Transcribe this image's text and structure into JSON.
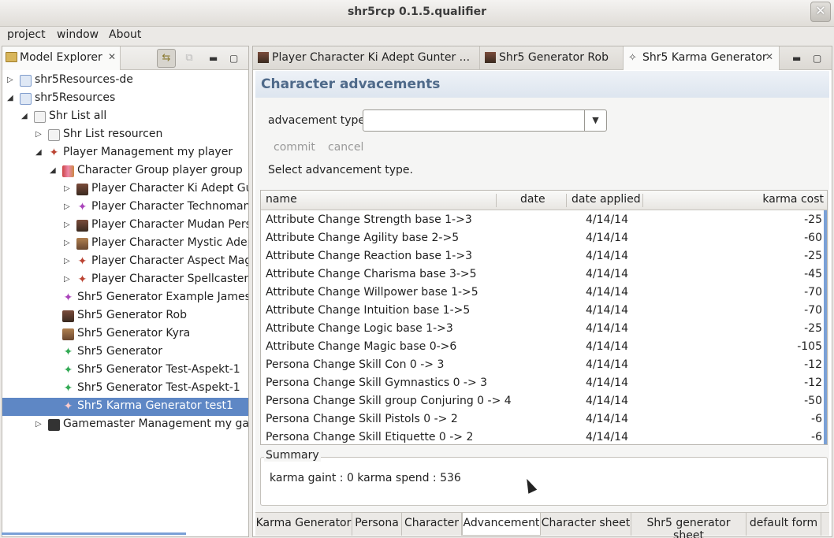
{
  "window": {
    "title": "shr5rcp 0.1.5.qualifier",
    "close_glyph": "✕"
  },
  "menu": [
    "project",
    "window",
    "About"
  ],
  "explorer": {
    "tab_label": "Model Explorer",
    "close_glyph": "✕",
    "tree": [
      {
        "label": "shr5Resources-de",
        "arrow": "▷"
      },
      {
        "label": "shr5Resources",
        "arrow": "◢"
      },
      {
        "label": "Shr List all",
        "arrow": "◢"
      },
      {
        "label": "Shr List resourcen",
        "arrow": "▷"
      },
      {
        "label": "Player Management my player",
        "arrow": "◢"
      },
      {
        "label": "Character Group player group",
        "arrow": "◢"
      },
      {
        "label": "Player Character Ki Adept Gunter",
        "arrow": "▷"
      },
      {
        "label": "Player Character Technomancer",
        "arrow": "▷"
      },
      {
        "label": "Player Character Mudan Persona",
        "arrow": "▷"
      },
      {
        "label": "Player Character Mystic Adept",
        "arrow": "▷"
      },
      {
        "label": "Player Character Aspect Magic",
        "arrow": "▷"
      },
      {
        "label": "Player Character Spellcaster t",
        "arrow": "▷"
      },
      {
        "label": "Shr5 Generator Example James",
        "arrow": ""
      },
      {
        "label": "Shr5 Generator Rob",
        "arrow": ""
      },
      {
        "label": "Shr5 Generator Kyra",
        "arrow": ""
      },
      {
        "label": "Shr5 Generator",
        "arrow": ""
      },
      {
        "label": "Shr5 Generator Test-Aspekt-1",
        "arrow": ""
      },
      {
        "label": "Shr5 Generator Test-Aspekt-1",
        "arrow": ""
      },
      {
        "label": "Shr5 Karma Generator test1",
        "arrow": ""
      },
      {
        "label": "Gamemaster Management my gam",
        "arrow": "▷"
      }
    ]
  },
  "editor_tabs": [
    {
      "label": "Player Character Ki Adept Gunter ..."
    },
    {
      "label": "Shr5 Generator Rob"
    },
    {
      "label": "Shr5 Karma Generator",
      "close_glyph": "✕"
    }
  ],
  "form": {
    "title": "Character advacements",
    "advancement_type_label": "advacement type",
    "advancement_type_value": "",
    "commit_label": "commit",
    "cancel_label": "cancel",
    "hint": "Select advancement type.",
    "columns": {
      "name": "name",
      "date": "date",
      "date_applied": "date applied",
      "karma_cost": "karma cost"
    },
    "rows": [
      {
        "name": "Attribute Change Strength base 1->3",
        "date": "",
        "date_applied": "4/14/14",
        "karma_cost": "-25"
      },
      {
        "name": "Attribute Change Agility base 2->5",
        "date": "",
        "date_applied": "4/14/14",
        "karma_cost": "-60"
      },
      {
        "name": "Attribute Change Reaction base 1->3",
        "date": "",
        "date_applied": "4/14/14",
        "karma_cost": "-25"
      },
      {
        "name": "Attribute Change Charisma base 3->5",
        "date": "",
        "date_applied": "4/14/14",
        "karma_cost": "-45"
      },
      {
        "name": "Attribute Change Willpower base 1->5",
        "date": "",
        "date_applied": "4/14/14",
        "karma_cost": "-70"
      },
      {
        "name": "Attribute Change Intuition base 1->5",
        "date": "",
        "date_applied": "4/14/14",
        "karma_cost": "-70"
      },
      {
        "name": "Attribute Change Logic base 1->3",
        "date": "",
        "date_applied": "4/14/14",
        "karma_cost": "-25"
      },
      {
        "name": "Attribute Change Magic base 0->6",
        "date": "",
        "date_applied": "4/14/14",
        "karma_cost": "-105"
      },
      {
        "name": "Persona Change Skill Con 0 -> 3",
        "date": "",
        "date_applied": "4/14/14",
        "karma_cost": "-12"
      },
      {
        "name": "Persona Change Skill Gymnastics 0 -> 3",
        "date": "",
        "date_applied": "4/14/14",
        "karma_cost": "-12"
      },
      {
        "name": "Persona Change Skill group Conjuring 0 -> 4",
        "date": "",
        "date_applied": "4/14/14",
        "karma_cost": "-50"
      },
      {
        "name": "Persona Change Skill Pistols 0 -> 2",
        "date": "",
        "date_applied": "4/14/14",
        "karma_cost": "-6"
      },
      {
        "name": "Persona Change Skill Etiquette 0 -> 2",
        "date": "",
        "date_applied": "4/14/14",
        "karma_cost": "-6"
      }
    ],
    "summary": {
      "legend": "Summary",
      "text": "karma gaint : 0 karma spend : 536"
    }
  },
  "bottom_tabs": [
    "Karma Generator",
    "Persona",
    "Character",
    "Advancement",
    "Character sheet",
    "Shr5 generator sheet",
    "default form"
  ],
  "active_bottom_tab": "Advancement"
}
